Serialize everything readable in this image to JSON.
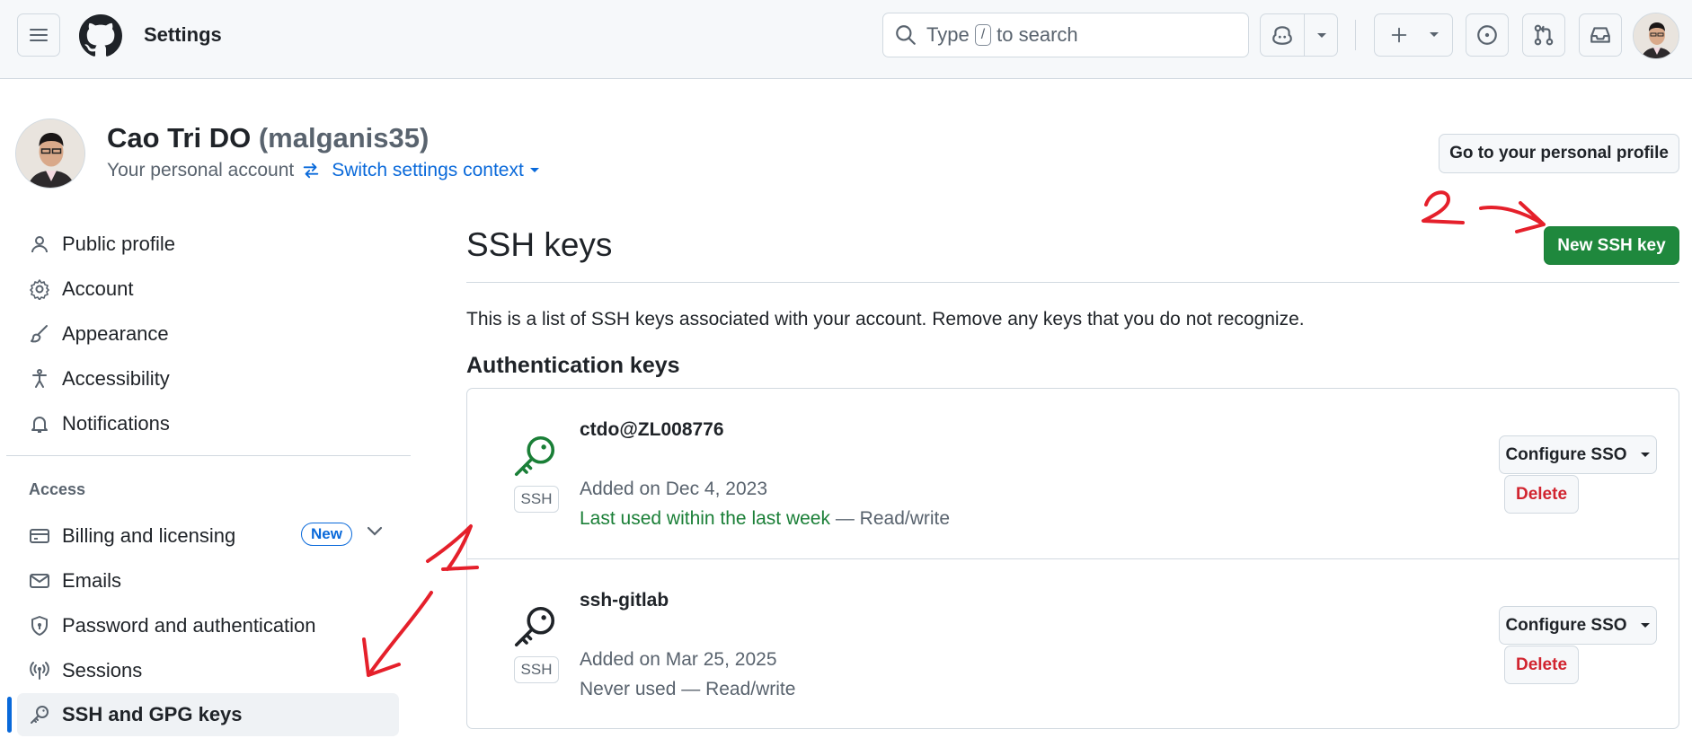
{
  "header": {
    "title": "Settings",
    "search_prefix": "Type",
    "search_key": "/",
    "search_suffix": "to search"
  },
  "profile": {
    "name": "Cao Tri DO",
    "login": "(malganis35)",
    "subtitle": "Your personal account",
    "switch_label": "Switch settings context",
    "goto_label": "Go to your personal profile"
  },
  "sidebar": {
    "items": [
      {
        "label": "Public profile",
        "icon": "person-icon"
      },
      {
        "label": "Account",
        "icon": "gear-icon"
      },
      {
        "label": "Appearance",
        "icon": "paintbrush-icon"
      },
      {
        "label": "Accessibility",
        "icon": "accessibility-icon"
      },
      {
        "label": "Notifications",
        "icon": "bell-icon"
      }
    ],
    "access_heading": "Access",
    "access_items": [
      {
        "label": "Billing and licensing",
        "icon": "credit-card-icon",
        "badge": "New"
      },
      {
        "label": "Emails",
        "icon": "mail-icon"
      },
      {
        "label": "Password and authentication",
        "icon": "shield-lock-icon"
      },
      {
        "label": "Sessions",
        "icon": "broadcast-icon"
      },
      {
        "label": "SSH and GPG keys",
        "icon": "key-icon",
        "active": true
      }
    ]
  },
  "main": {
    "title": "SSH keys",
    "new_button": "New SSH key",
    "description": "This is a list of SSH keys associated with your account. Remove any keys that you do not recognize.",
    "section_heading": "Authentication keys",
    "keys": [
      {
        "name": "ctdo@ZL008776",
        "type_label": "SSH",
        "added": "Added on Dec 4, 2023",
        "last_used": "Last used within the last week",
        "access": "— Read/write",
        "icon_color": "#1a7f37",
        "configure_label": "Configure SSO",
        "delete_label": "Delete"
      },
      {
        "name": "ssh-gitlab",
        "type_label": "SSH",
        "added": "Added on Mar 25, 2025",
        "last_used": "Never used",
        "access": "— Read/write",
        "icon_color": "#1f2328",
        "configure_label": "Configure SSO",
        "delete_label": "Delete"
      }
    ]
  },
  "annotations": {
    "mark_1": "1",
    "mark_2": "2",
    "color": "#e5202b"
  },
  "colors": {
    "accent": "#0969da",
    "primary_button": "#1f883d",
    "danger": "#d1242f"
  }
}
